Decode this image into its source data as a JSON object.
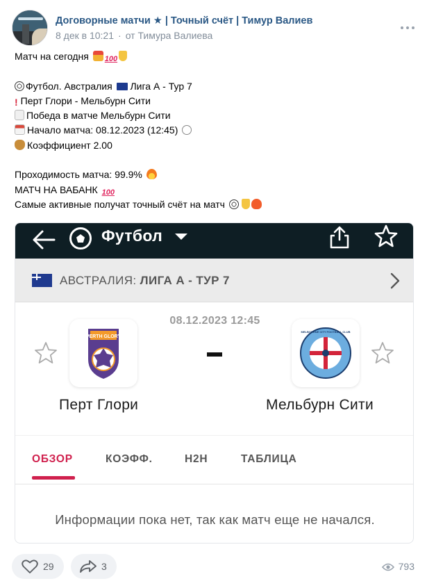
{
  "post": {
    "title": "Договорные матчи ★ | Точный счёт | Тимур Валиев",
    "date": "8 дек в 10:21",
    "author": "от Тимура Валиева"
  },
  "text": {
    "line1": "Матч на сегодня",
    "line2": "Футбол. Австралия",
    "line2b": "Лига А - Тур 7",
    "line3": "Перт Глори - Мельбурн Сити",
    "line4": "Победа в матче Мельбурн Сити",
    "line5": "Начало матча: 08.12.2023 (12:45)",
    "line6": "Коэффициент 2.00",
    "line7": "Проходимость матча: 99.9%",
    "line8": "МАТЧ НА ВАБАНК",
    "line9": "Самые активные получат точный счёт на матч",
    "hundred": "100"
  },
  "app": {
    "sport": "Футбол",
    "country": "АВСТРАЛИЯ:",
    "league": "ЛИГА А - ТУР 7",
    "match_date": "08.12.2023 12:45",
    "score_separator": "-",
    "home_team": "Перт Глори",
    "away_team": "Мельбурн Сити",
    "home_logo_text": "PERTH GLORY",
    "away_logo_text": "MELBOURNE CITY FOOTBALL CLUB",
    "tabs": [
      "ОБЗОР",
      "КОЭФФ.",
      "H2H",
      "ТАБЛИЦА"
    ],
    "info": "Информации пока нет, так как матч еще не начался."
  },
  "footer": {
    "likes": "29",
    "shares": "3",
    "views": "793"
  },
  "colors": {
    "link": "#2a5885",
    "topbar": "#0e1e24",
    "accent": "#d0204d"
  },
  "icons": [
    "more-icon",
    "gift-icon",
    "hundred-icon",
    "thumb-down-icon",
    "soccer-ball-icon",
    "australia-flag-icon",
    "exclamation-icon",
    "memo-icon",
    "calendar-icon",
    "clock-icon",
    "money-bag-icon",
    "fire-icon",
    "heart-icon",
    "back-arrow-icon",
    "caret-down-icon",
    "share-icon",
    "star-icon",
    "chevron-right-icon",
    "like-icon",
    "repost-icon",
    "eye-icon"
  ]
}
